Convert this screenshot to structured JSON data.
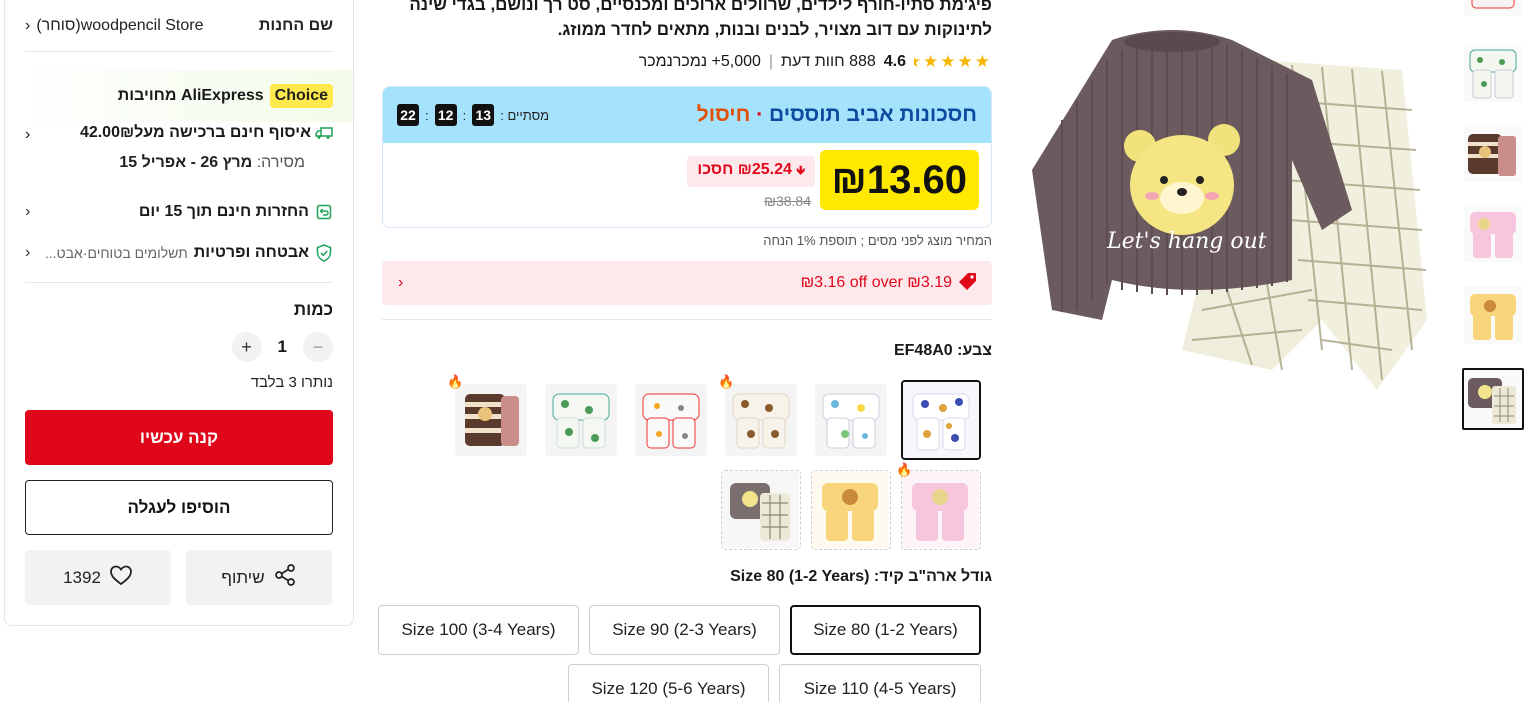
{
  "store": {
    "label": "שם החנות",
    "name": "woodpencil Store(סוחר)"
  },
  "choice": {
    "badge": "Choice",
    "text": "AliExpress מחויבות"
  },
  "shipping": {
    "title": "איסוף חינם ברכישה מעל42.00₪",
    "delivery_prefix": "מסירה:",
    "delivery_dates": "מרץ 26 - אפריל 15"
  },
  "returns": {
    "text": "החזרות חינם תוך 15 יום"
  },
  "security": {
    "title": "אבטחה ופרטיות",
    "sub": "תשלומים בטוחים·אבט..."
  },
  "quantity": {
    "label": "כמות",
    "value": "1",
    "remaining": "נותרו 3 בלבד"
  },
  "actions": {
    "buy_now": "קנה עכשיו",
    "add_to_cart": "הוסיפו לעגלה",
    "share": "שיתוף",
    "wishlist_count": "1392"
  },
  "product": {
    "title_line1": "פיג'מת סתיו-חורף לילדים, שרוולים ארוכים ומכנסיים, סט רך ונושם, בגדי שינה",
    "title_line2": "לתינוקות עם דוב מצויר, לבנים ובנות, מתאים לחדר ממוזג."
  },
  "rating": {
    "stars": "★★★★",
    "half_star": "★",
    "score": "4.6",
    "reviews": "888 חוות דעת",
    "sold": "5,000+ נמכרנמכר"
  },
  "promo": {
    "name": "חסכונות אביב תוססים",
    "dot": "·",
    "tag": "חיסול",
    "ends_label": "מסתיים :",
    "timer": [
      "13",
      "12",
      "22"
    ],
    "price": "₪13.60",
    "save": "₪25.24 חסכו",
    "original_price": "₪38.84"
  },
  "tax_note": "המחיר מוצג לפני מסים ; תוספת 1% הנחה",
  "coupon": {
    "text": "₪3.16 off over ₪3.19"
  },
  "color": {
    "label": "צבע: EF48A0"
  },
  "size": {
    "label": "גודל ארה\"ב קיד: Size 80 (1-2 Years)",
    "options": [
      "Size 80 (1-2 Years)",
      "Size 90 (2-3 Years)",
      "Size 100 (3-4 Years)",
      "Size 110 (4-5 Years)",
      "Size 120 (5-6 Years)"
    ]
  },
  "colors_theme": {
    "accent_red": "#e1071b",
    "price_yellow": "#ffe900",
    "promo_blue": "#a5e3fd"
  }
}
